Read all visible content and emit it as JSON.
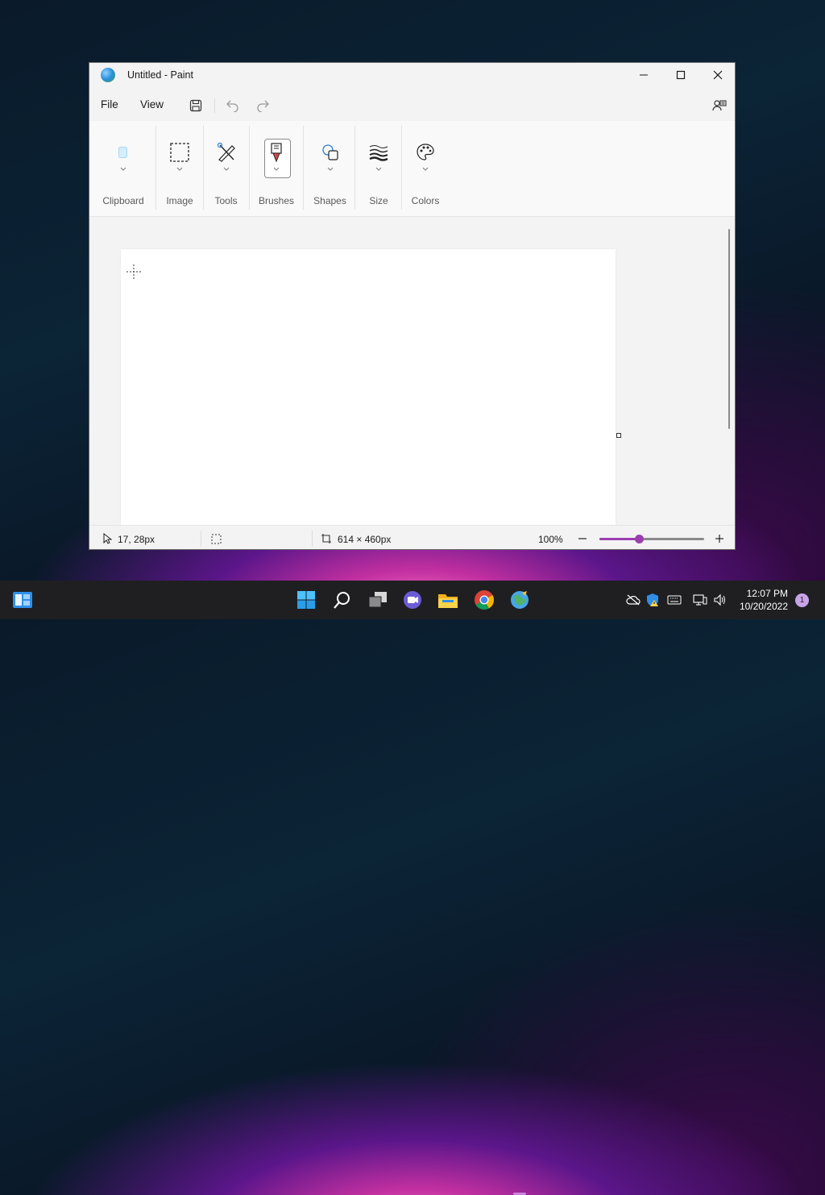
{
  "window": {
    "title": "Untitled - Paint"
  },
  "menubar": {
    "file_label": "File",
    "view_label": "View"
  },
  "ribbon": {
    "groups": [
      {
        "label": "Clipboard"
      },
      {
        "label": "Image"
      },
      {
        "label": "Tools"
      },
      {
        "label": "Brushes"
      },
      {
        "label": "Shapes"
      },
      {
        "label": "Size"
      },
      {
        "label": "Colors"
      }
    ]
  },
  "statusbar": {
    "cursor_position": "17, 28px",
    "canvas_size": "614 × 460px",
    "zoom_level": "100%",
    "zoom_fraction": 0.38
  },
  "taskbar": {
    "time": "12:07 PM",
    "date": "10/20/2022",
    "notification_count": "1"
  },
  "colors": {
    "accent": "#9b3fb0",
    "taskbar_bg": "#1f1f22",
    "window_bg": "#f3f3f3"
  },
  "icons": {
    "app": "paint-icon",
    "clipboard": "clipboard-icon",
    "image": "selection-icon",
    "tools": "tools-icon",
    "brushes": "brush-icon",
    "shapes": "shapes-icon",
    "size": "size-icon",
    "colors": "palette-icon"
  }
}
